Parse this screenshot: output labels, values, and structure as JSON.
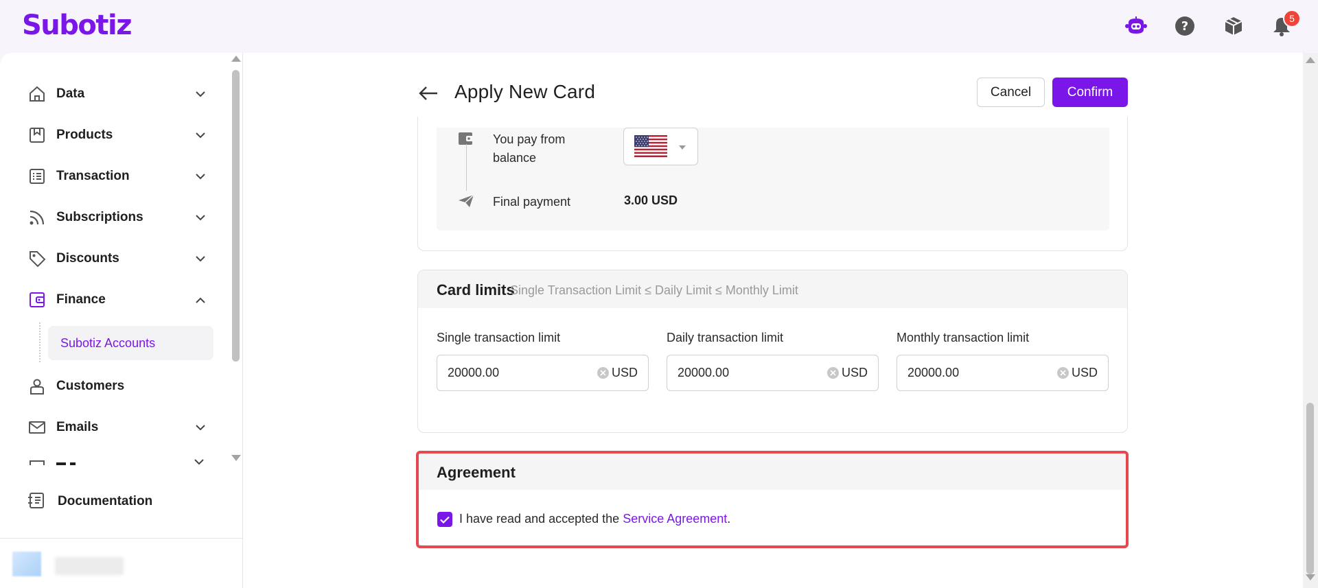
{
  "app": {
    "logo_text": "Subotiz",
    "brand_color": "#7b16e8"
  },
  "header": {
    "icons": [
      "assistant-bot-icon",
      "help-icon",
      "package-icon",
      "bell-icon"
    ],
    "notification_count": "5"
  },
  "sidebar": {
    "items": [
      {
        "label": "Data",
        "icon": "home-icon",
        "expandable": true
      },
      {
        "label": "Products",
        "icon": "product-icon",
        "expandable": true
      },
      {
        "label": "Transaction",
        "icon": "list-icon",
        "expandable": true
      },
      {
        "label": "Subscriptions",
        "icon": "rss-icon",
        "expandable": true
      },
      {
        "label": "Discounts",
        "icon": "tag-icon",
        "expandable": true
      },
      {
        "label": "Finance",
        "icon": "wallet-icon",
        "expandable": true,
        "expanded": true
      },
      {
        "label": "Customers",
        "icon": "user-icon",
        "expandable": false
      },
      {
        "label": "Emails",
        "icon": "mail-icon",
        "expandable": true
      }
    ],
    "active_sub_item": "Subotiz Accounts",
    "documentation_label": "Documentation"
  },
  "page": {
    "title": "Apply New Card",
    "cancel_label": "Cancel",
    "confirm_label": "Confirm"
  },
  "payment": {
    "pay_from_label_line1": "You pay from",
    "pay_from_label_line2": "balance",
    "currency_flag": "us-flag-icon",
    "final_payment_label": "Final payment",
    "final_payment_value": "3.00 USD"
  },
  "limits": {
    "title": "Card limits",
    "hint": "Single Transaction Limit ≤ Daily Limit ≤ Monthly Limit",
    "fields": [
      {
        "label": "Single transaction limit",
        "value": "20000.00",
        "unit": "USD"
      },
      {
        "label": "Daily transaction limit",
        "value": "20000.00",
        "unit": "USD"
      },
      {
        "label": "Monthly transaction limit",
        "value": "20000.00",
        "unit": "USD"
      }
    ]
  },
  "agreement": {
    "title": "Agreement",
    "checked": true,
    "text_prefix": "I have read and accepted the ",
    "link_text": "Service Agreement",
    "text_suffix": ".",
    "highlight_color": "#e5484d"
  }
}
